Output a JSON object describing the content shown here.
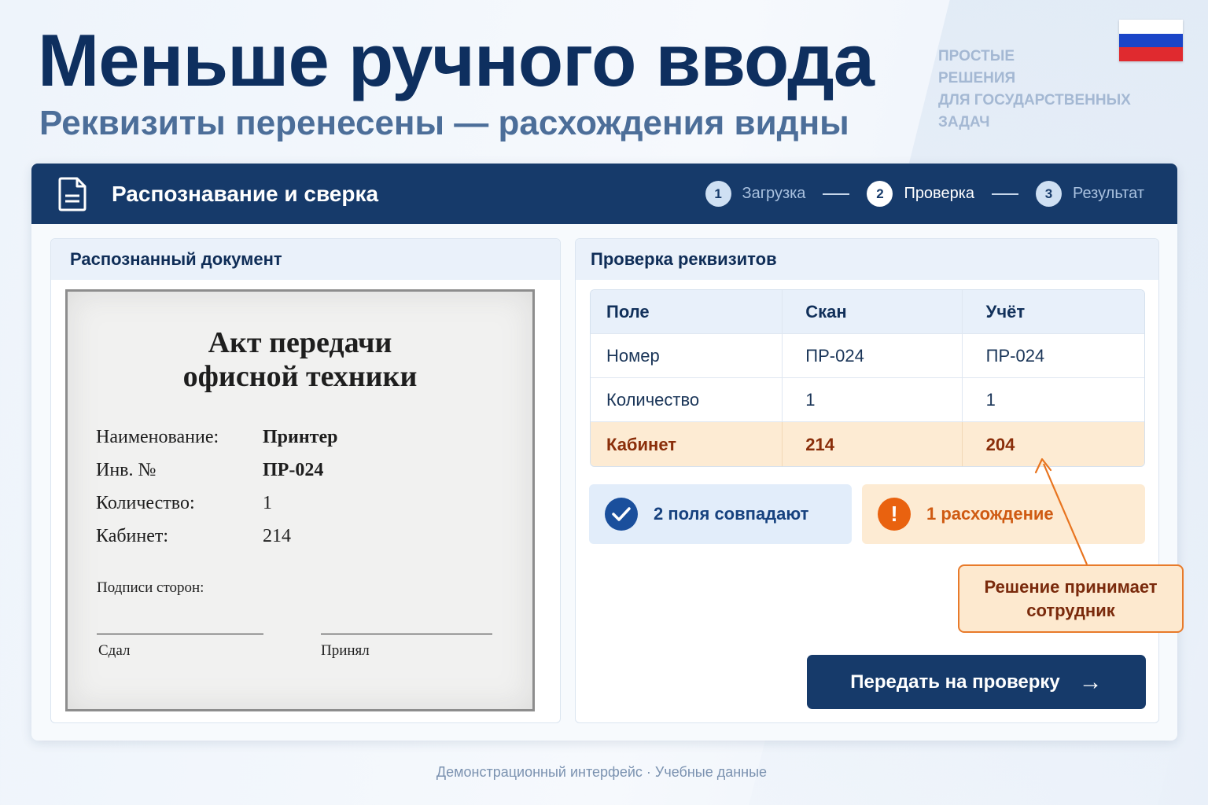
{
  "hero": {
    "title": "Меньше ручного ввода",
    "subtitle": "Реквизиты перенесены — расхождения видны"
  },
  "tagline": [
    "ПРОСТЫЕ",
    "РЕШЕНИЯ",
    "ДЛЯ ГОСУДАРСТВЕННЫХ",
    "ЗАДАЧ"
  ],
  "flag": {
    "colors": [
      "#ffffff",
      "#1b45c8",
      "#e02a2f"
    ]
  },
  "app": {
    "title": "Распознавание и сверка",
    "icon": "document-icon",
    "steps": [
      {
        "num": "1",
        "label": "Загрузка",
        "state": "done"
      },
      {
        "num": "2",
        "label": "Проверка",
        "state": "active"
      },
      {
        "num": "3",
        "label": "Результат",
        "state": "pending"
      }
    ]
  },
  "left_panel": {
    "title": "Распознанный документ",
    "document": {
      "title_line1": "Акт передачи",
      "title_line2": "офисной техники",
      "fields": [
        {
          "label": "Наименование:",
          "value": "Принтер"
        },
        {
          "label": "Инв. №",
          "value": "ПР-024"
        },
        {
          "label": "Количество:",
          "value": "1"
        },
        {
          "label": "Кабинет:",
          "value": "214"
        }
      ],
      "signatures_label": "Подписи сторон:",
      "signer_left": "Сдал",
      "signer_right": "Принял"
    }
  },
  "right_panel": {
    "title": "Проверка реквизитов",
    "table": {
      "headers": [
        "Поле",
        "Скан",
        "Учёт"
      ],
      "rows": [
        {
          "field": "Номер",
          "scan": "ПР-024",
          "record": "ПР-024",
          "mismatch": false
        },
        {
          "field": "Количество",
          "scan": "1",
          "record": "1",
          "mismatch": false
        },
        {
          "field": "Кабинет",
          "scan": "214",
          "record": "204",
          "mismatch": true
        }
      ]
    },
    "match_badge": "2 поля совпадают",
    "mismatch_badge": "1 расхождение",
    "callout_line1": "Решение принимает",
    "callout_line2": "сотрудник",
    "submit_label": "Передать на проверку",
    "colors": {
      "accent": "#163a6a",
      "warning": "#e9620f",
      "ok": "#1a4f9c"
    }
  },
  "footer": "Демонстрационный интерфейс · Учебные данные"
}
